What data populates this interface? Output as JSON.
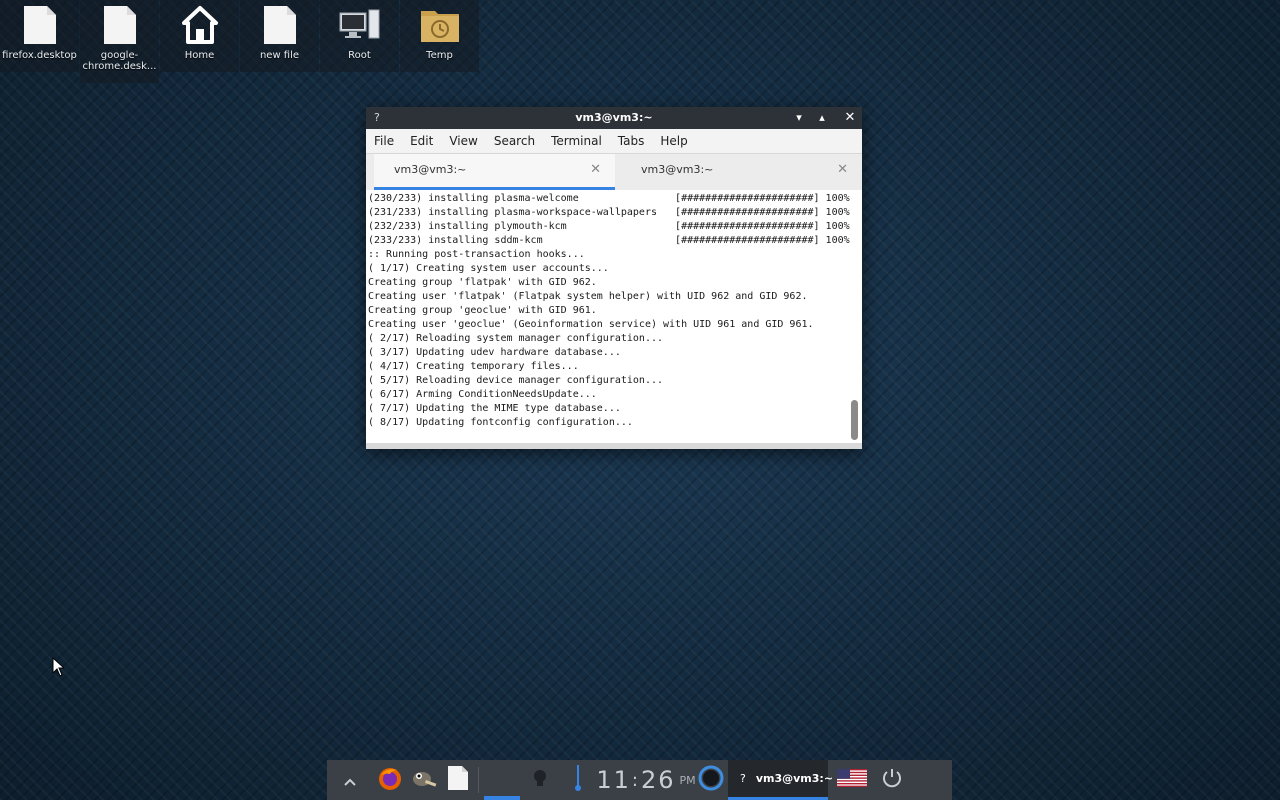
{
  "desktop": {
    "icons": [
      {
        "label": "firefox.desktop",
        "icon": "file-icon"
      },
      {
        "label": "google-chrome.desk...",
        "icon": "file-icon"
      },
      {
        "label": "Home",
        "icon": "home-icon"
      },
      {
        "label": "new file",
        "icon": "file-icon"
      },
      {
        "label": "Root",
        "icon": "computer-icon"
      },
      {
        "label": "Temp",
        "icon": "folder-clock-icon"
      }
    ]
  },
  "terminal": {
    "title": "vm3@vm3:~",
    "app_icon": "?",
    "controls": {
      "minimize": "▾",
      "maximize": "▴",
      "close": "✕"
    },
    "menu": [
      "File",
      "Edit",
      "View",
      "Search",
      "Terminal",
      "Tabs",
      "Help"
    ],
    "tabs": [
      {
        "label": "vm3@vm3:~",
        "close": "✕"
      },
      {
        "label": "vm3@vm3:~",
        "close": "✕"
      }
    ],
    "lines": [
      "(230/233) installing plasma-welcome                [######################] 100%",
      "(231/233) installing plasma-workspace-wallpapers   [######################] 100%",
      "(232/233) installing plymouth-kcm                  [######################] 100%",
      "(233/233) installing sddm-kcm                      [######################] 100%",
      ":: Running post-transaction hooks...",
      "( 1/17) Creating system user accounts...",
      "Creating group 'flatpak' with GID 962.",
      "Creating user 'flatpak' (Flatpak system helper) with UID 962 and GID 962.",
      "Creating group 'geoclue' with GID 961.",
      "Creating user 'geoclue' (Geoinformation service) with UID 961 and GID 961.",
      "( 2/17) Reloading system manager configuration...",
      "( 3/17) Updating udev hardware database...",
      "( 4/17) Creating temporary files...",
      "( 5/17) Reloading device manager configuration...",
      "( 6/17) Arming ConditionNeedsUpdate...",
      "( 7/17) Updating the MIME type database...",
      "( 8/17) Updating fontconfig configuration..."
    ]
  },
  "taskbar": {
    "clock_h": "11",
    "clock_sep": ":",
    "clock_m": "26",
    "clock_ampm": "PM",
    "window_task": {
      "icon": "?",
      "label": "vm3@vm3:~"
    },
    "colors": {
      "accent": "#3584e4",
      "bar": "#3b4046"
    }
  }
}
